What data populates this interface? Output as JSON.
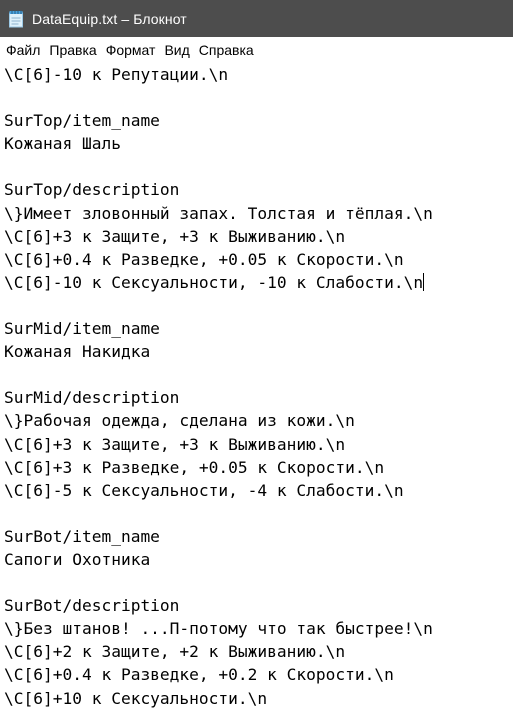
{
  "window": {
    "title": "DataEquip.txt – Блокнот"
  },
  "menu": {
    "items": [
      "Файл",
      "Правка",
      "Формат",
      "Вид",
      "Справка"
    ]
  },
  "editor": {
    "lines": [
      "\\C[6]-10 к Репутации.\\n",
      "",
      "SurTop/item_name",
      "Кожаная Шаль",
      "",
      "SurTop/description",
      "\\}Имеет зловонный запах. Толстая и тёплая.\\n",
      "\\C[6]+3 к Защите, +3 к Выживанию.\\n",
      "\\C[6]+0.4 к Разведке, +0.05 к Скорости.\\n",
      "\\C[6]-10 к Сексуальности, -10 к Слабости.\\n",
      "",
      "SurMid/item_name",
      "Кожаная Накидка",
      "",
      "SurMid/description",
      "\\}Рабочая одежда, сделана из кожи.\\n",
      "\\C[6]+3 к Защите, +3 к Выживанию.\\n",
      "\\C[6]+3 к Разведке, +0.05 к Скорости.\\n",
      "\\C[6]-5 к Сексуальности, -4 к Слабости.\\n",
      "",
      "SurBot/item_name",
      "Сапоги Охотника",
      "",
      "SurBot/description",
      "\\}Без штанов! ...П-потому что так быстрее!\\n",
      "\\C[6]+2 к Защите, +2 к Выживанию.\\n",
      "\\C[6]+0.4 к Разведке, +0.2 к Скорости.\\n",
      "\\C[6]+10 к Сексуальности.\\n"
    ]
  }
}
